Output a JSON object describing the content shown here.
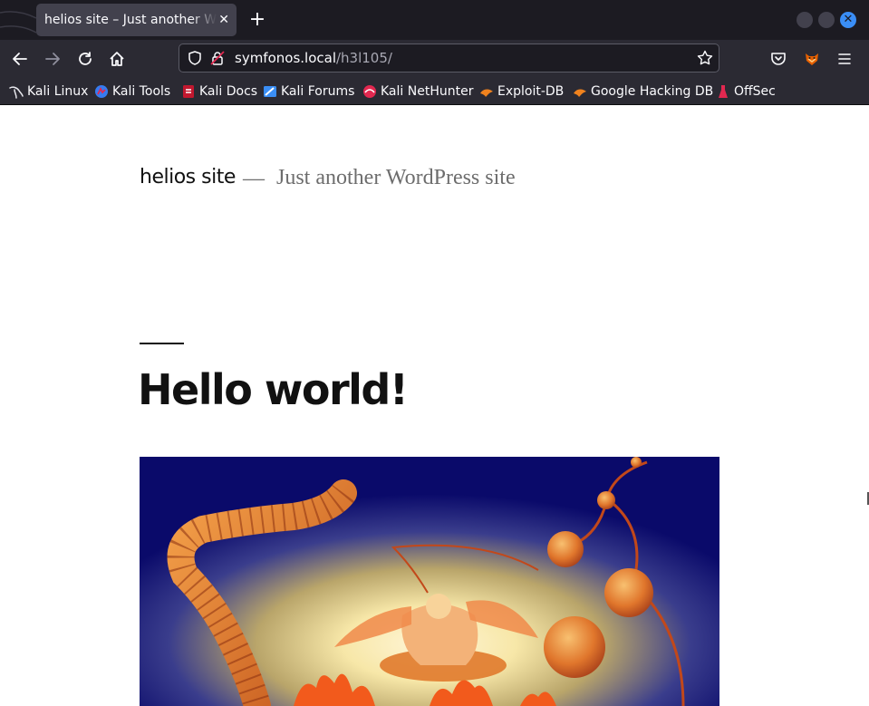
{
  "browser": {
    "tab": {
      "title": "helios site – Just another WordPress site"
    },
    "url": {
      "host": "symfonos.local",
      "path": "/h3l105/"
    },
    "bookmarks": [
      {
        "label": "Kali Linux",
        "icon": "kali-dragon-icon"
      },
      {
        "label": "Kali Tools",
        "icon": "kali-tools-icon"
      },
      {
        "label": "Kali Docs",
        "icon": "kali-docs-icon"
      },
      {
        "label": "Kali Forums",
        "icon": "kali-forums-icon"
      },
      {
        "label": "Kali NetHunter",
        "icon": "kali-nethunter-icon"
      },
      {
        "label": "Exploit-DB",
        "icon": "exploit-db-icon"
      },
      {
        "label": "Google Hacking DB",
        "icon": "ghdb-icon"
      },
      {
        "label": "OffSec",
        "icon": "offsec-icon"
      }
    ],
    "colors": {
      "chrome_dark": "#1c1b22",
      "toolbar": "#2b2a33",
      "accent": "#3a8ef6"
    }
  },
  "site": {
    "title": "helios site",
    "separator": "—",
    "description": "Just another WordPress site"
  },
  "post": {
    "title": "Hello world!",
    "featured_image": "helios-sun-god-illustration"
  }
}
